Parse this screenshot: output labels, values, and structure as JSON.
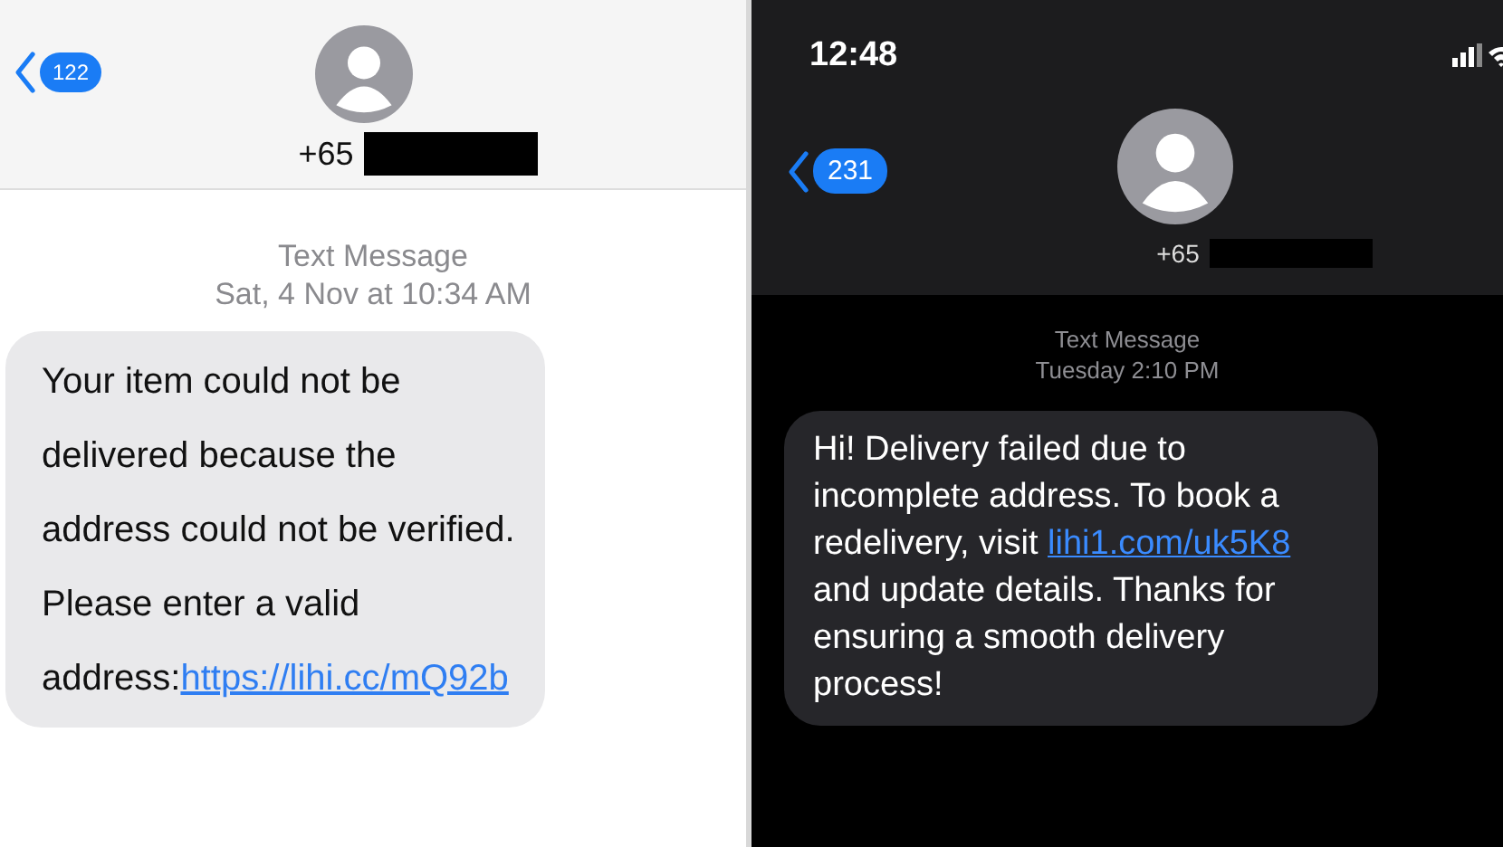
{
  "screens": [
    {
      "kind": "light",
      "back_badge": "122",
      "contact": "+65",
      "meta": {
        "label": "Text Message",
        "time": "Sat, 4 Nov at 10:34 AM"
      },
      "message": [
        {
          "text": "Your item could not be delivered because the address could not be verified. Please enter a valid address:",
          "link": false
        },
        {
          "text": "https://lihi.cc/mQ92b",
          "link": true
        }
      ]
    },
    {
      "kind": "dark",
      "status_bar": {
        "time": "12:48"
      },
      "back_badge": "231",
      "contact": "+65",
      "meta": {
        "label": "Text Message",
        "time": "Tuesday 2:10 PM"
      },
      "message": [
        {
          "text": "Hi! Delivery failed due to incomplete address. To book a redelivery, visit ",
          "link": false
        },
        {
          "text": "lihi1.com/uk5K8",
          "link": true
        },
        {
          "text": " and update details. Thanks for ensuring a smooth delivery process!",
          "link": false
        }
      ]
    }
  ]
}
